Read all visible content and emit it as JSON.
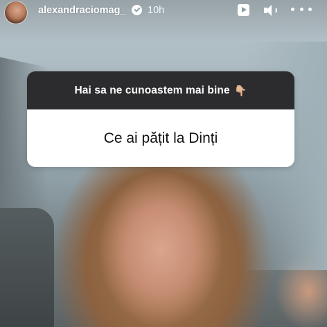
{
  "story": {
    "username": "alexandraciomag_",
    "time_ago": "10h",
    "verified": true,
    "controls": {
      "play": "play-icon",
      "volume": "volume-icon",
      "more": "more-icon"
    }
  },
  "question_sticker": {
    "prompt": "Hai sa ne cunoastem mai bine",
    "prompt_emoji": "👇🏼",
    "answer": "Ce ai pățit la Dinți"
  },
  "colors": {
    "sticker_header_bg": "#2c2c2e",
    "sticker_body_bg": "#ffffff",
    "text_light": "#ffffff",
    "text_dark": "#111111"
  }
}
